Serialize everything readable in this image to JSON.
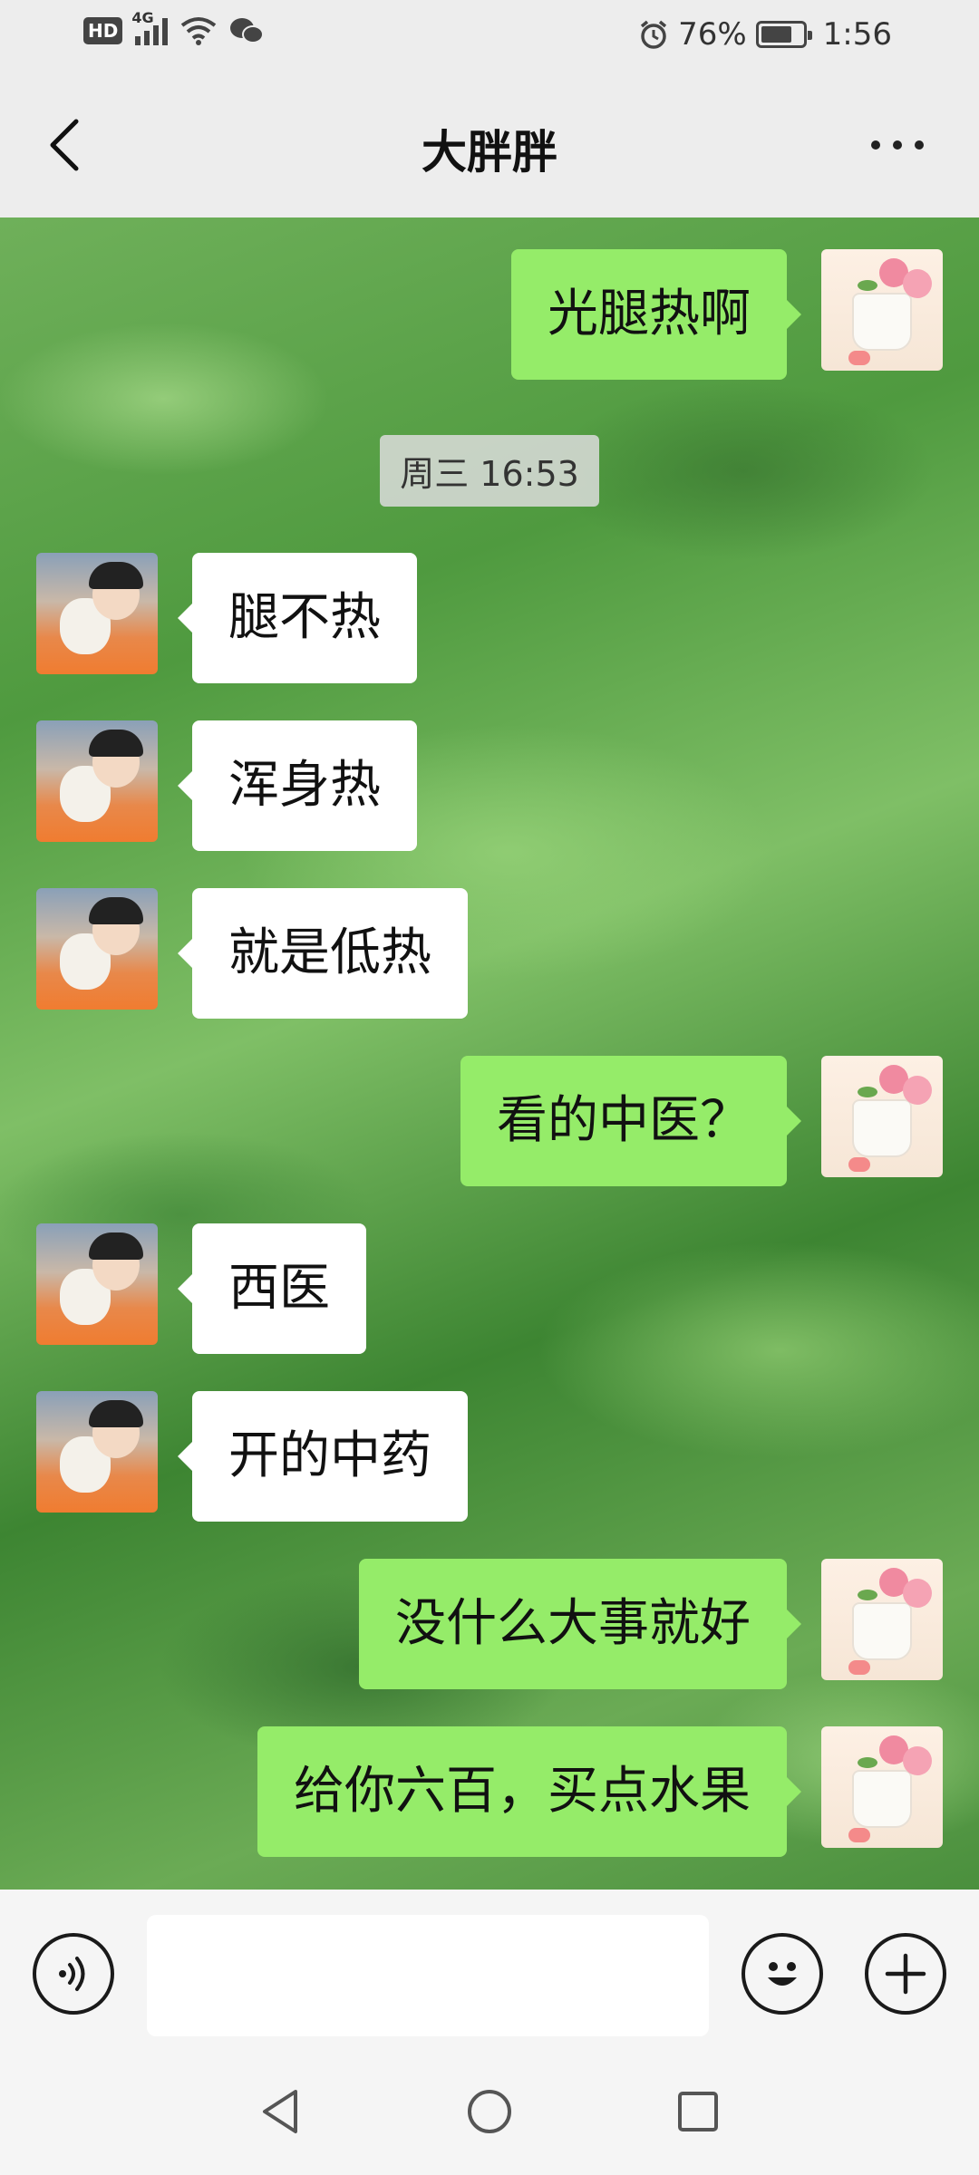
{
  "status_bar": {
    "hd": "HD",
    "network": "4G",
    "battery_percent": "76%",
    "battery_level": 0.76,
    "time": "1:56"
  },
  "header": {
    "title": "大胖胖"
  },
  "chat": {
    "timestamp": "周三 16:53",
    "messages": [
      {
        "side": "right",
        "text": "光腿热啊"
      },
      {
        "side": "left",
        "text": "腿不热"
      },
      {
        "side": "left",
        "text": "浑身热"
      },
      {
        "side": "left",
        "text": "就是低热"
      },
      {
        "side": "right",
        "text": "看的中医？"
      },
      {
        "side": "left",
        "text": "西医"
      },
      {
        "side": "left",
        "text": "开的中药"
      },
      {
        "side": "right",
        "text": "没什么大事就好"
      },
      {
        "side": "right",
        "text": "给你六百，买点水果"
      }
    ]
  },
  "input_bar": {
    "value": "",
    "placeholder": ""
  },
  "colors": {
    "self_bubble": "#95ec69",
    "friend_bubble": "#ffffff",
    "bar_background": "#ededed"
  },
  "icons": {
    "back": "chevron-left-icon",
    "more": "more-dots-icon",
    "voice": "voice-icon",
    "emoji": "emoji-icon",
    "add": "plus-icon",
    "nav_back": "triangle-back-icon",
    "nav_home": "circle-home-icon",
    "nav_recent": "square-recents-icon"
  }
}
